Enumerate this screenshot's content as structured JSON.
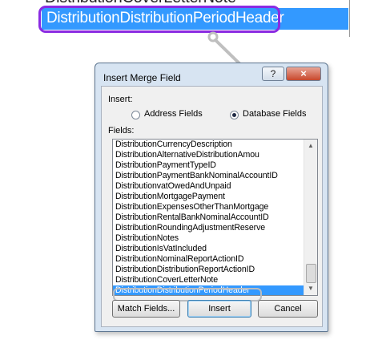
{
  "zoom": {
    "previous_item": "DistributionCoverLetterNote",
    "selected_item": "DistributionDistributionPeriodHeader"
  },
  "dialog": {
    "title": "Insert Merge Field",
    "help_label": "?",
    "close_label": "×",
    "insert_label": "Insert:",
    "option_address": "Address Fields",
    "option_database": "Database Fields",
    "selected_option": "Database Fields",
    "fields_label": "Fields:",
    "fields": [
      "DistributionCurrencyDescription",
      "DistributionAlternativeDistributionAmou",
      "DistributionPaymentTypeID",
      "DistributionPaymentBankNominalAccountID",
      "DistributionvatOwedAndUnpaid",
      "DistributionMortgagePayment",
      "DistributionExpensesOtherThanMortgage",
      "DistributionRentalBankNominalAccountID",
      "DistributionRoundingAdjustmentReserve",
      "DistributionNotes",
      "DistributionIsVatIncluded",
      "DistributionNominalReportActionID",
      "DistributionDistributionReportActionID",
      "DistributionCoverLetterNote",
      "DistributionDistributionPeriodHeader"
    ],
    "selected_field": "DistributionDistributionPeriodHeader",
    "scroll_up": "▲",
    "scroll_down": "▼",
    "match_button": "Match Fields...",
    "insert_button": "Insert",
    "cancel_button": "Cancel"
  }
}
